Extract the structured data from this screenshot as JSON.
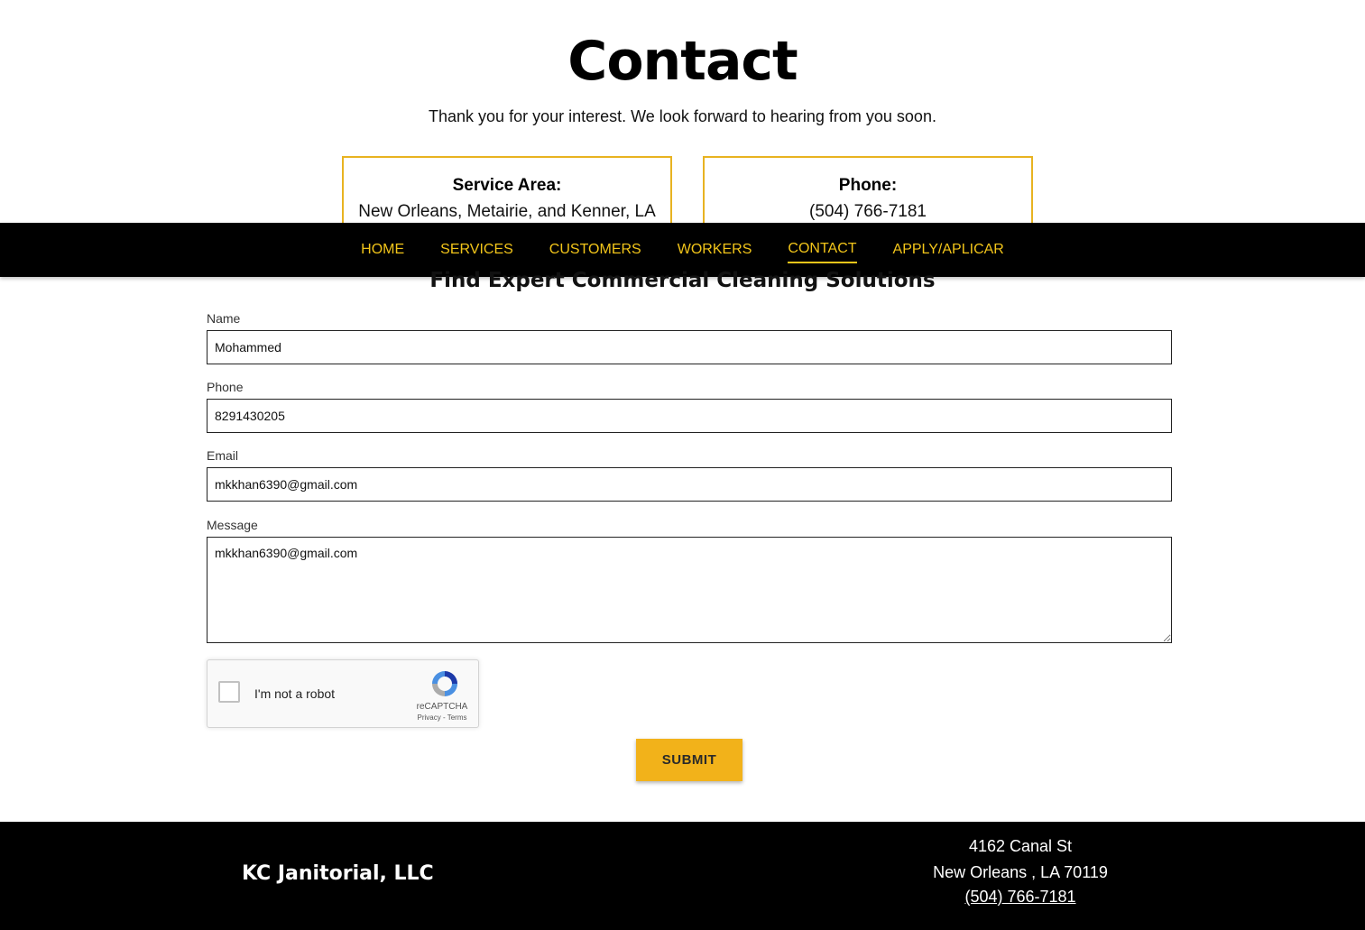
{
  "header": {
    "title": "Contact",
    "subtitle": "Thank you for your interest. We look forward to hearing from you soon."
  },
  "info_boxes": [
    {
      "label": "Service Area:",
      "value": "New Orleans, Metairie, and Kenner, LA"
    },
    {
      "label": "Phone:",
      "value": "(504) 766-7181"
    }
  ],
  "nav": {
    "items": [
      "HOME",
      "SERVICES",
      "CUSTOMERS",
      "WORKERS",
      "CONTACT",
      "APPLY/APLICAR"
    ],
    "active": "CONTACT"
  },
  "form": {
    "heading": "Find Expert Commercial Cleaning Solutions",
    "name_label": "Name",
    "name_value": "Mohammed",
    "phone_label": "Phone",
    "phone_value": "8291430205",
    "email_label": "Email",
    "email_value": "mkkhan6390@gmail.com",
    "message_label": "Message",
    "message_value": "mkkhan6390@gmail.com",
    "submit_label": "SUBMIT"
  },
  "recaptcha": {
    "label": "I'm not a robot",
    "brand": "reCAPTCHA",
    "links": "Privacy - Terms"
  },
  "footer": {
    "brand": "KC Janitorial, LLC",
    "address_line1": "4162 Canal St",
    "address_line2": "New Orleans , LA 70119",
    "phone": "(504) 766-7181"
  },
  "colors": {
    "accent": "#f2c51a",
    "box_border": "#e8b321",
    "button": "#f2b21a",
    "nav_background": "#000000"
  }
}
